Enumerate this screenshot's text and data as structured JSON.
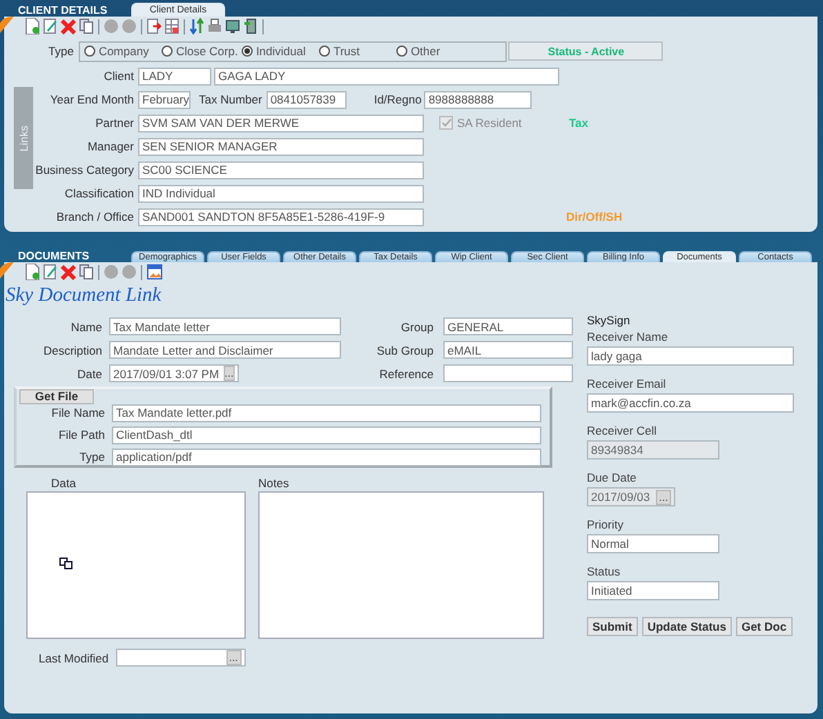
{
  "client": {
    "title": "CLIENT DETAILS",
    "tabs": [
      {
        "label": "Client Details",
        "selected": true
      }
    ],
    "type": {
      "label": "Type",
      "options": [
        {
          "label": "Company",
          "selected": false
        },
        {
          "label": "Close Corp.",
          "selected": false
        },
        {
          "label": "Individual",
          "selected": true
        },
        {
          "label": "Trust",
          "selected": false
        },
        {
          "label": "Other",
          "selected": false
        }
      ]
    },
    "status_button": "Status - Active",
    "links_label": "Links",
    "client_label": "Client",
    "client_code": "LADY",
    "client_name": "GAGA LADY",
    "year_end": {
      "label": "Year End Month",
      "value": "February"
    },
    "tax_number": {
      "label": "Tax Number",
      "value": "0841057839"
    },
    "id_regno": {
      "label": "Id/Regno",
      "value": "8988888888"
    },
    "rows": [
      {
        "label": "Partner",
        "value": "SVM SAM VAN DER MERWE"
      },
      {
        "label": "Manager",
        "value": "SEN SENIOR MANAGER"
      },
      {
        "label": "Business Category",
        "value": "SC00 SCIENCE"
      },
      {
        "label": "Classification",
        "value": "IND Individual"
      },
      {
        "label": "Branch / Office",
        "value": "SAND001 SANDTON 8F5A85E1-5286-419F-9"
      }
    ],
    "sa_resident": {
      "label": "SA Resident",
      "checked": true,
      "disabled": true
    },
    "tax_link": "Tax",
    "dir_link": "Dir/Off/SH"
  },
  "documents": {
    "title": "DOCUMENTS",
    "tabs": [
      {
        "label": "Demographics",
        "selected": false
      },
      {
        "label": "User Fields",
        "selected": false
      },
      {
        "label": "Other Details",
        "selected": false
      },
      {
        "label": "Tax Details",
        "selected": false
      },
      {
        "label": "Wip Client",
        "selected": false
      },
      {
        "label": "Sec Client",
        "selected": false
      },
      {
        "label": "Billing Info",
        "selected": false
      },
      {
        "label": "Documents",
        "selected": true
      },
      {
        "label": "Contacts",
        "selected": false
      }
    ],
    "heading": "Sky Document Link",
    "rows": [
      {
        "left": {
          "label": "Name",
          "value": "Tax Mandate letter"
        },
        "right": {
          "label": "Group",
          "value": "GENERAL"
        }
      },
      {
        "left": {
          "label": "Description",
          "value": "Mandate Letter and Disclaimer"
        },
        "right": {
          "label": "Sub Group",
          "value": "eMAIL"
        }
      },
      {
        "left": {
          "label": "Date",
          "value": "2017/09/01 3:07 PM",
          "picker": "..."
        },
        "right": {
          "label": "Reference"
        }
      }
    ],
    "get_file": {
      "button": "Get File",
      "fields": [
        {
          "label": "File Name",
          "value": "Tax Mandate letter.pdf"
        },
        {
          "label": "File Path",
          "value": "ClientDash_dtl"
        },
        {
          "label": "Type",
          "value": "application/pdf"
        }
      ]
    },
    "data_label": "Data",
    "notes_label": "Notes",
    "last_modified": {
      "label": "Last Modified",
      "picker": "..."
    },
    "skysign": {
      "title": "SkySign",
      "fields": [
        {
          "label": "Receiver Name",
          "value": "lady gaga",
          "disabled": false
        },
        {
          "label": "Receiver Email",
          "value": "mark@accfin.co.za",
          "disabled": false
        },
        {
          "label": "Receiver Cell",
          "value": "89349834",
          "disabled": true
        },
        {
          "label": "Due Date",
          "value": "2017/09/03",
          "disabled": true,
          "picker": "..."
        },
        {
          "label": "Priority",
          "value": "Normal",
          "disabled": false
        },
        {
          "label": "Status",
          "value": "Initiated",
          "disabled": false
        }
      ],
      "buttons": [
        "Submit",
        "Update Status",
        "Get Doc"
      ]
    }
  }
}
